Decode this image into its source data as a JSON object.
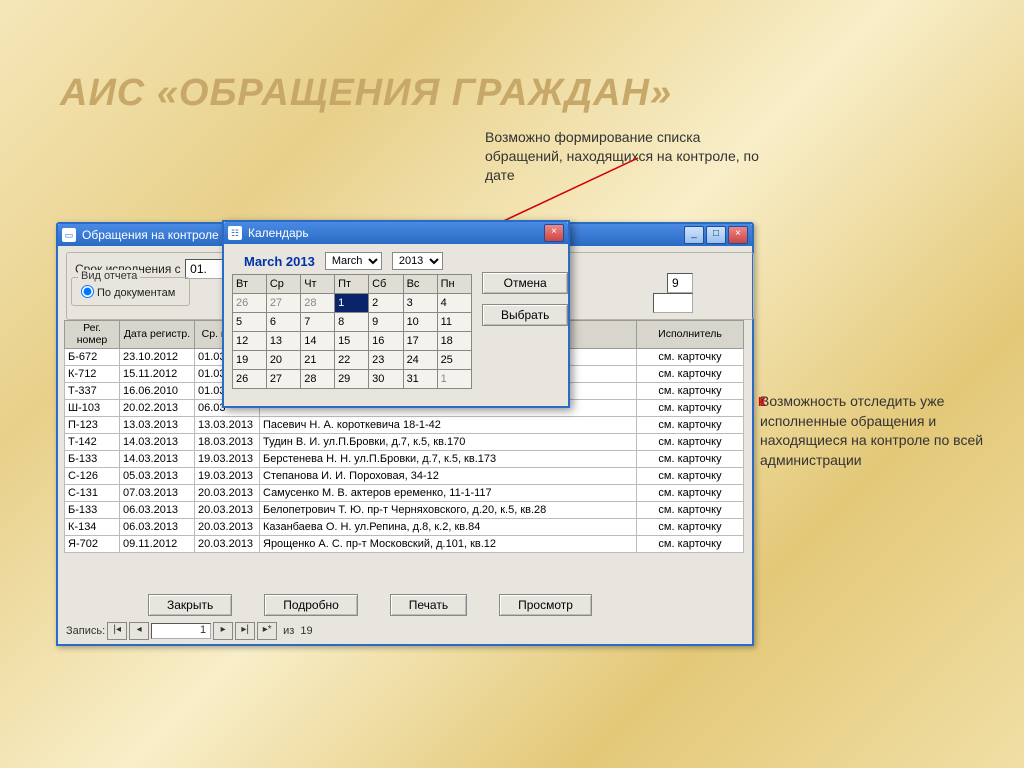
{
  "slide": {
    "title": "АИС «ОБРАЩЕНИЯ ГРАЖДАН»",
    "note1": "Возможно формирование списка обращений, находящихся на контроле, по дате",
    "note2": "Возможность отследить уже исполненные обращения и находящиеся на контроле по всей администрации"
  },
  "main_window": {
    "title": "Обращения на контроле",
    "filter_label": "Срок исполнения с",
    "date_from": "01.",
    "report_type_label": "Вид отчета",
    "radio_docs": "По документам",
    "col_headers": [
      "Рег. номер",
      "Дата регистр.",
      "Ср. испол.",
      "",
      "Исполнитель"
    ],
    "extra_field": "9",
    "red_marker": "К",
    "rows": [
      {
        "reg": "Б-672",
        "date": "23.10.2012",
        "due": "01.03",
        "desc": "",
        "exec": "см. карточку"
      },
      {
        "reg": "К-712",
        "date": "15.11.2012",
        "due": "01.03",
        "desc": "",
        "exec": "см. карточку"
      },
      {
        "reg": "Т-337",
        "date": "16.06.2010",
        "due": "01.03",
        "desc": "",
        "exec": "см. карточку"
      },
      {
        "reg": "Ш-103",
        "date": "20.02.2013",
        "due": "06.03",
        "desc": "",
        "exec": "см. карточку"
      },
      {
        "reg": "П-123",
        "date": "13.03.2013",
        "due": "13.03.2013",
        "desc": "Пасевич Н. А. короткевича 18-1-42",
        "exec": "см. карточку"
      },
      {
        "reg": "Т-142",
        "date": "14.03.2013",
        "due": "18.03.2013",
        "desc": "Тудин В. И. ул.П.Бровки, д.7, к.5, кв.170",
        "exec": "см. карточку"
      },
      {
        "reg": "Б-133",
        "date": "14.03.2013",
        "due": "19.03.2013",
        "desc": "Берстенева Н. Н. ул.П.Бровки, д.7, к.5, кв.173",
        "exec": "см. карточку"
      },
      {
        "reg": "С-126",
        "date": "05.03.2013",
        "due": "19.03.2013",
        "desc": "Степанова И. И. Пороховая, 34-12",
        "exec": "см. карточку"
      },
      {
        "reg": "С-131",
        "date": "07.03.2013",
        "due": "20.03.2013",
        "desc": "Самусенко М. В. актеров еременко, 11-1-117",
        "exec": "см. карточку"
      },
      {
        "reg": "Б-133",
        "date": "06.03.2013",
        "due": "20.03.2013",
        "desc": "Белопетрович Т. Ю. пр-т Черняховского, д.20, к.5, кв.28",
        "exec": "см. карточку"
      },
      {
        "reg": "К-134",
        "date": "06.03.2013",
        "due": "20.03.2013",
        "desc": "Казанбаева О. Н. ул.Репина, д.8, к.2, кв.84",
        "exec": "см. карточку"
      },
      {
        "reg": "Я-702",
        "date": "09.11.2012",
        "due": "20.03.2013",
        "desc": "Ярощенко А. С. пр-т Московский, д.101, кв.12",
        "exec": "см. карточку"
      }
    ],
    "buttons": {
      "close": "Закрыть",
      "detail": "Подробно",
      "print": "Печать",
      "view": "Просмотр"
    },
    "recnav": {
      "label": "Запись:",
      "pos": "1",
      "of_label": "из",
      "total": "19"
    }
  },
  "calendar": {
    "title": "Календарь",
    "month_year": "March 2013",
    "month_sel": "March",
    "year_sel": "2013",
    "cancel": "Отмена",
    "select": "Выбрать",
    "dow": [
      "Вт",
      "Ср",
      "Чт",
      "Пт",
      "Сб",
      "Вс",
      "Пн"
    ],
    "weeks": [
      [
        {
          "d": "26",
          "o": true
        },
        {
          "d": "27",
          "o": true
        },
        {
          "d": "28",
          "o": true
        },
        {
          "d": "1",
          "sel": true
        },
        {
          "d": "2"
        },
        {
          "d": "3"
        },
        {
          "d": "4"
        }
      ],
      [
        {
          "d": "5"
        },
        {
          "d": "6"
        },
        {
          "d": "7"
        },
        {
          "d": "8"
        },
        {
          "d": "9"
        },
        {
          "d": "10"
        },
        {
          "d": "11"
        }
      ],
      [
        {
          "d": "12"
        },
        {
          "d": "13"
        },
        {
          "d": "14"
        },
        {
          "d": "15"
        },
        {
          "d": "16"
        },
        {
          "d": "17"
        },
        {
          "d": "18"
        }
      ],
      [
        {
          "d": "19"
        },
        {
          "d": "20"
        },
        {
          "d": "21"
        },
        {
          "d": "22"
        },
        {
          "d": "23"
        },
        {
          "d": "24"
        },
        {
          "d": "25"
        }
      ],
      [
        {
          "d": "26"
        },
        {
          "d": "27"
        },
        {
          "d": "28"
        },
        {
          "d": "29"
        },
        {
          "d": "30"
        },
        {
          "d": "31"
        },
        {
          "d": "1",
          "o": true
        }
      ]
    ]
  }
}
